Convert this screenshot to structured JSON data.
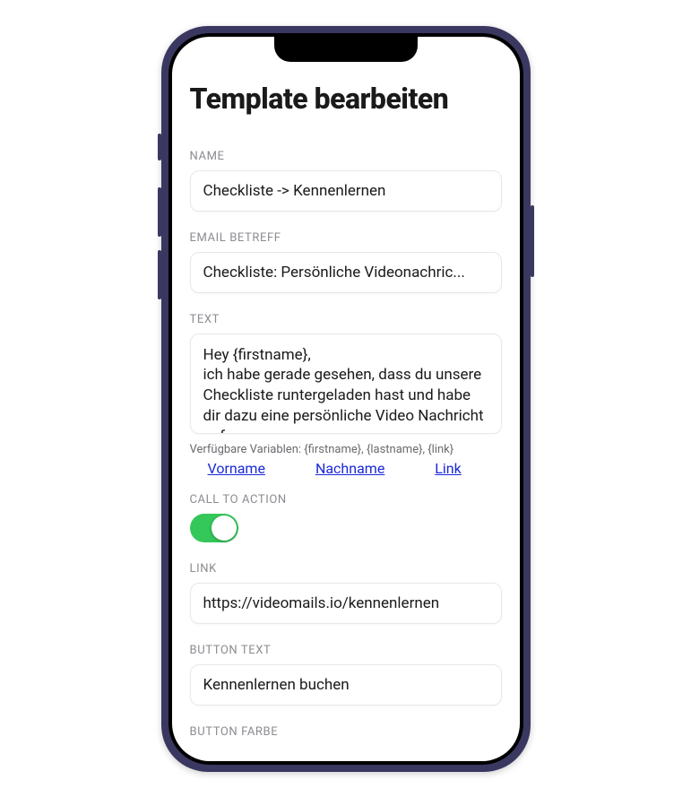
{
  "page": {
    "title": "Template bearbeiten"
  },
  "labels": {
    "name": "NAME",
    "email_subject": "EMAIL BETREFF",
    "text": "TEXT",
    "cta": "CALL TO ACTION",
    "link": "LINK",
    "button_text": "BUTTON TEXT",
    "button_color": "BUTTON FARBE"
  },
  "fields": {
    "name": "Checkliste -> Kennenlernen",
    "email_subject": "Checkliste: Persönliche Videonachric...",
    "text": "Hey {firstname},\nich habe gerade gesehen, dass du unsere Checkliste runtergeladen hast und habe dir dazu eine persönliche Video Nachricht aufgenommen.",
    "link": "https://videomails.io/kennenlernen",
    "button_text": "Kennenlernen buchen"
  },
  "variables": {
    "hint": "Verfügbare Variablen: {firstname}, {lastname}, {link}",
    "links": {
      "firstname": "Vorname",
      "lastname": "Nachname",
      "link": "Link"
    }
  },
  "cta_enabled": true
}
